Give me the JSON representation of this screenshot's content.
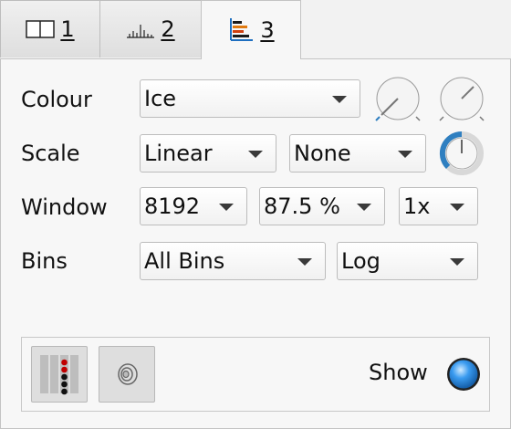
{
  "tabs": [
    {
      "label": "1",
      "icon": "split-view-icon"
    },
    {
      "label": "2",
      "icon": "histogram-icon"
    },
    {
      "label": "3",
      "icon": "spectrogram-icon",
      "active": true
    }
  ],
  "rows": {
    "colour": {
      "label": "Colour",
      "value": "Ice"
    },
    "scale": {
      "label": "Scale",
      "value1": "Linear",
      "value2": "None"
    },
    "window": {
      "label": "Window",
      "value1": "8192",
      "value2": "87.5 %",
      "value3": "1x"
    },
    "bins": {
      "label": "Bins",
      "value1": "All Bins",
      "value2": "Log"
    }
  },
  "bottom": {
    "show_label": "Show"
  },
  "colors": {
    "accent": "#2f7fc0",
    "led": "#3a9bf0",
    "peak_red": "#c00000"
  }
}
